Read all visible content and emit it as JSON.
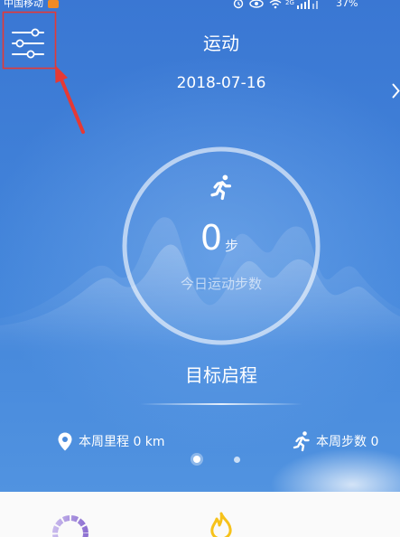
{
  "status_bar": {
    "carrier": "中国移动",
    "network_type": "2G",
    "battery_percent": "37%",
    "icons": [
      "carrier-badge-icon",
      "alarm-icon",
      "eye-icon",
      "wifi-icon",
      "signal-icon"
    ]
  },
  "header": {
    "title": "运动",
    "date": "2018-07-16",
    "left_icon": "sliders-icon",
    "right_icon": "chevron-right-icon"
  },
  "today": {
    "icon": "runner-icon",
    "steps": "0",
    "unit": "步",
    "caption": "今日运动步数"
  },
  "goal": {
    "label": "目标启程"
  },
  "weekly": {
    "distance": {
      "icon": "location-pin-icon",
      "label": "本周里程 0 km"
    },
    "steps": {
      "icon": "runner-icon",
      "label": "本周步数 0"
    }
  },
  "pager": {
    "pages": 2,
    "active_index": 0
  },
  "bottom_cards": [
    {
      "icon": "progress-ring-icon"
    },
    {
      "icon": "flame-icon"
    }
  ],
  "colors": {
    "bg_top": "#3a77d3",
    "bg_bottom": "#5193e0",
    "panel": "#fafafa",
    "annotation": "#e53935",
    "flame": "#f6c21b",
    "ring_purple": "#9f86d8"
  }
}
